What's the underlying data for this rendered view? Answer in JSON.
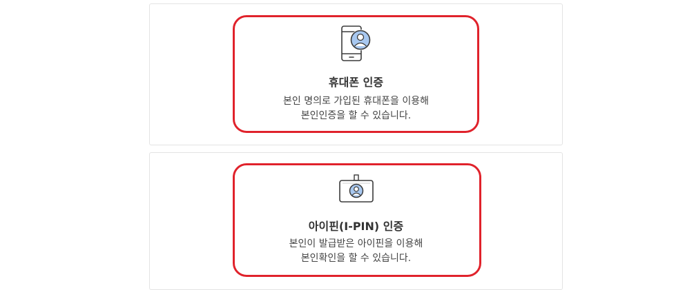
{
  "auth_options": {
    "phone": {
      "title": "휴대폰 인증",
      "desc_line1": "본인 명의로 가입된 휴대폰을 이용해",
      "desc_line2": "본인인증을 할 수 있습니다.",
      "icon": "mobile-phone-user-icon"
    },
    "ipin": {
      "title": "아이핀(I-PIN) 인증",
      "desc_line1": "본인이 발급받은 아이핀을 이용해",
      "desc_line2": "본인확인을 할 수 있습니다.",
      "icon": "id-card-badge-icon"
    }
  },
  "colors": {
    "highlight": "#e0222b",
    "icon_blue": "#a8c8f0",
    "icon_stroke": "#3a3a3a",
    "card_border": "#e3e3e3"
  }
}
